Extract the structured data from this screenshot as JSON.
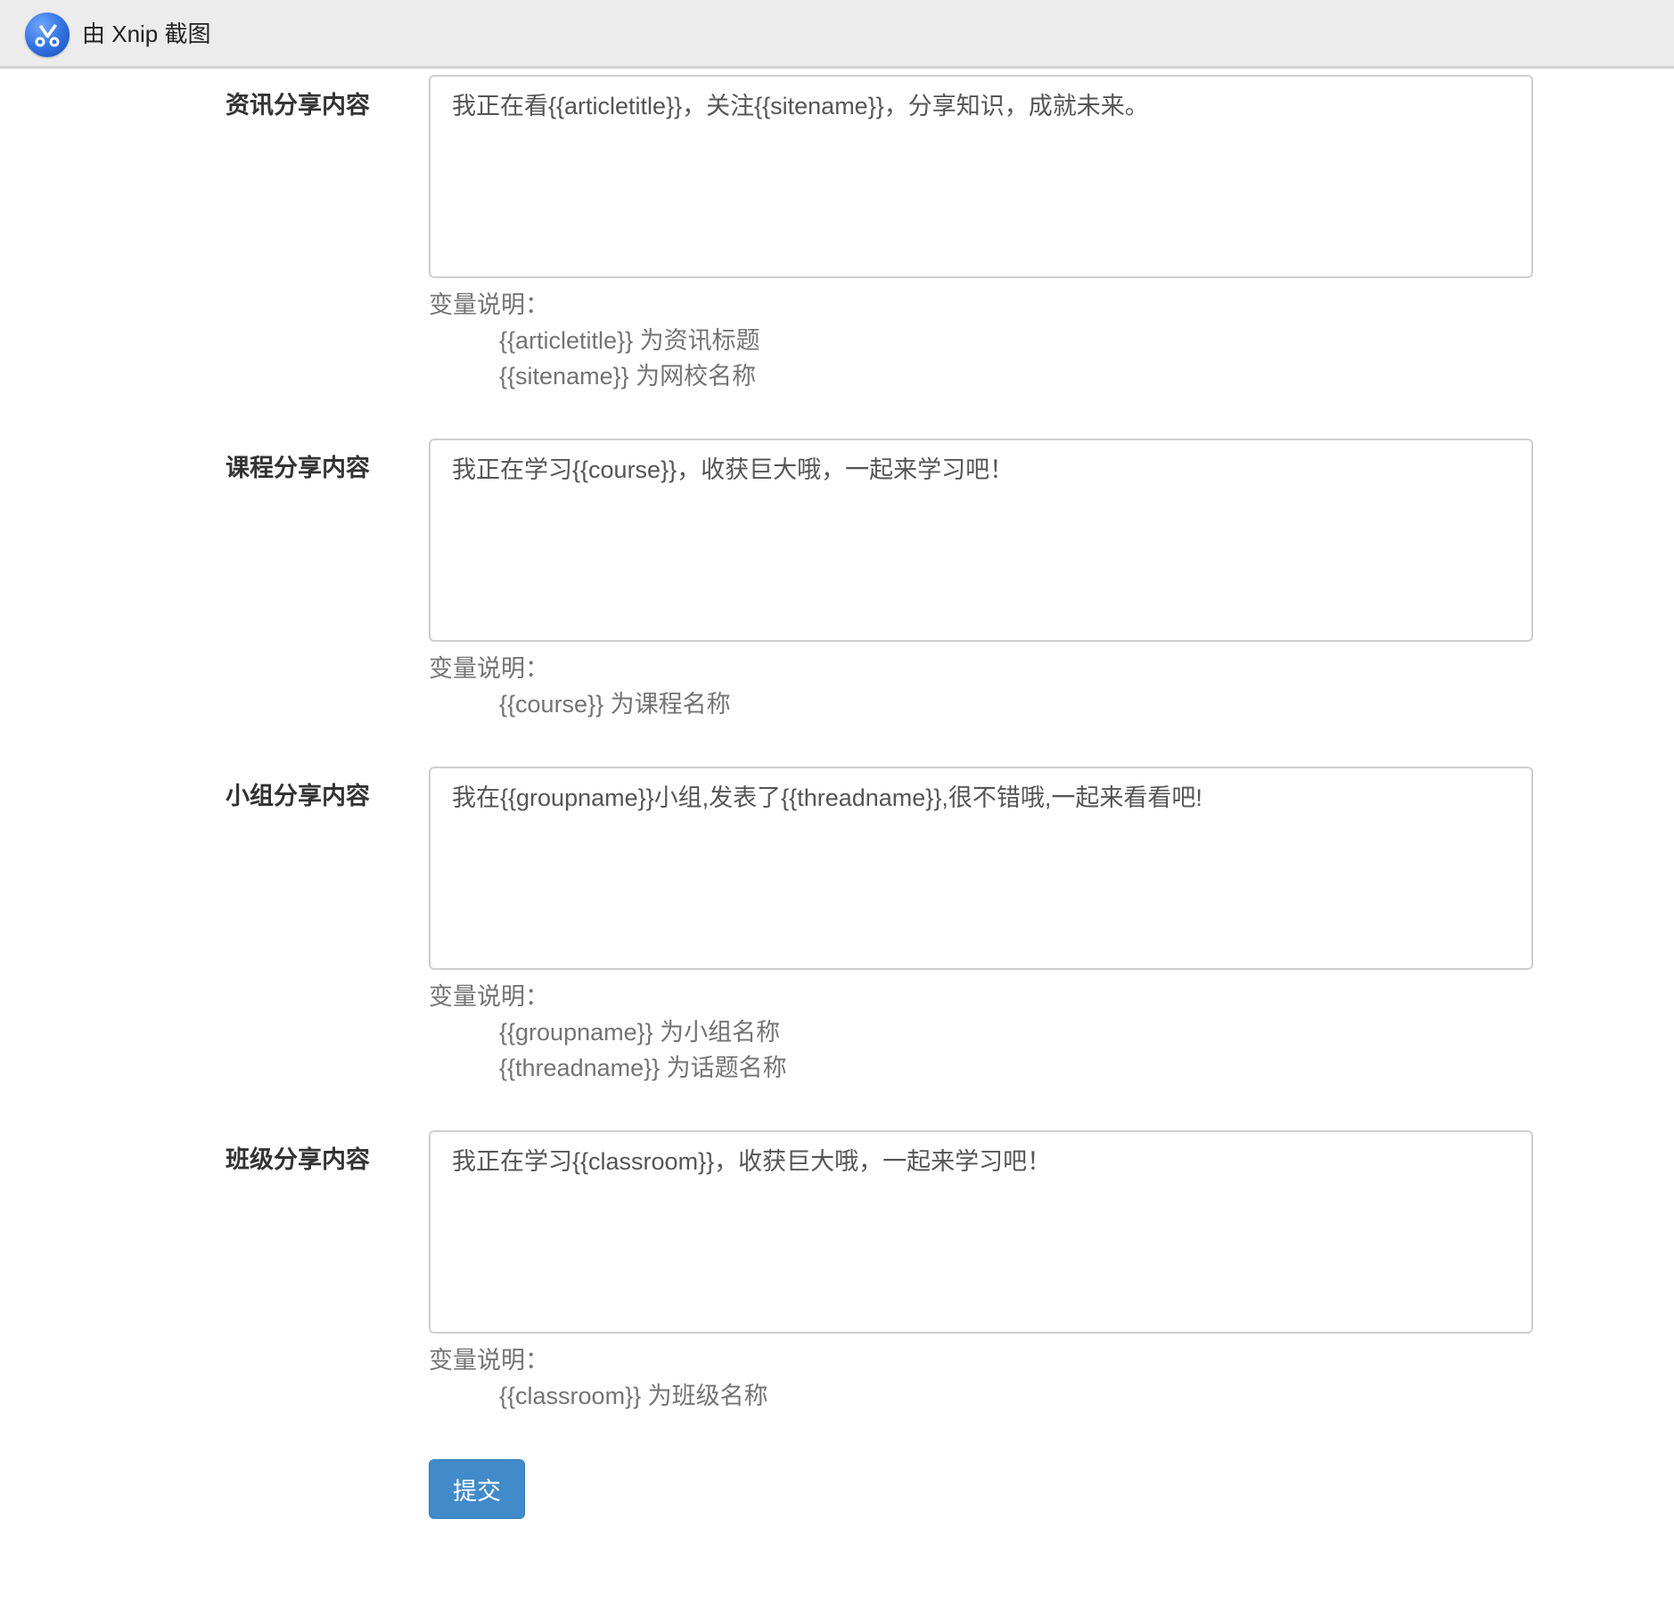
{
  "topbar": {
    "title": "由 Xnip 截图",
    "logo_icon": "xnip-logo-icon",
    "background": "#ececec"
  },
  "sections": [
    {
      "label": "资讯分享内容",
      "value": "我正在看{{articletitle}}，关注{{sitename}}，分享知识，成就未来。",
      "help_title": "变量说明：",
      "help_items": [
        "{{articletitle}} 为资讯标题",
        "{{sitename}} 为网校名称"
      ]
    },
    {
      "label": "课程分享内容",
      "value": "我正在学习{{course}}，收获巨大哦，一起来学习吧！",
      "help_title": "变量说明：",
      "help_items": [
        "{{course}} 为课程名称"
      ]
    },
    {
      "label": "小组分享内容",
      "value": "我在{{groupname}}小组,发表了{{threadname}},很不错哦,一起来看看吧!",
      "help_title": "变量说明：",
      "help_items": [
        "{{groupname}} 为小组名称",
        "{{threadname}} 为话题名称"
      ]
    },
    {
      "label": "班级分享内容",
      "value": "我正在学习{{classroom}}，收获巨大哦，一起来学习吧！",
      "help_title": "变量说明：",
      "help_items": [
        "{{classroom}} 为班级名称"
      ]
    }
  ],
  "submit": {
    "label": "提交",
    "color": "#428bca"
  }
}
